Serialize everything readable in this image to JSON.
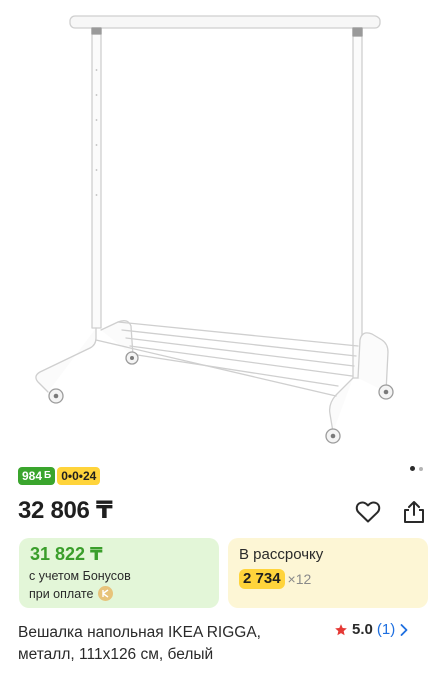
{
  "product_image": {
    "icon": "clothes-rack-image"
  },
  "gallery": {
    "dots": 2,
    "active_index": 1
  },
  "badges": {
    "bonus": "984",
    "bonus_symbol": "Б",
    "installment": "0•0•24"
  },
  "price": "32 806 ₸",
  "bonus_card": {
    "price": "31 822 ₸",
    "line1": "с учетом Бонусов",
    "line2": "при оплате"
  },
  "credit_card": {
    "title": "В рассрочку",
    "amount": "2 734",
    "times": "×12"
  },
  "product": {
    "title": "Вешалка напольная IKEA RIGGA, металл, 111x126 см, белый",
    "rating": "5.0",
    "reviews": "(1)"
  },
  "colors": {
    "bonus_green": "#3aa52d",
    "installment_yellow": "#ffd43b",
    "rating_star": "#e53935",
    "link_blue": "#1e6fe0"
  }
}
